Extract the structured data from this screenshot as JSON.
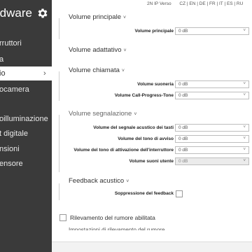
{
  "sidebar": {
    "brand": "rdware",
    "items": [
      {
        "label": "rruttori",
        "active": false
      },
      {
        "label": "a",
        "active": false
      },
      {
        "label": "io",
        "active": true
      },
      {
        "label": "ocamera",
        "active": false
      },
      {
        "label": "oilluminazione",
        "active": false
      },
      {
        "label": "t digitale",
        "active": false
      },
      {
        "label": "nsioni",
        "active": false
      },
      {
        "label": "ensore",
        "active": false
      }
    ]
  },
  "topbar": {
    "version": "2N IP Verso",
    "languages": "CZ | EN | DE | FR | IT | ES | RU"
  },
  "sections": {
    "principale": {
      "title": "Volume principale",
      "rows": [
        {
          "label": "Volume principale",
          "value": "0 dB"
        }
      ]
    },
    "adattativo": {
      "title": "Volume adattativo"
    },
    "chiamata": {
      "title": "Volume chiamata",
      "rows": [
        {
          "label": "Volume suoneria",
          "value": "0 dB"
        },
        {
          "label": "Volume Call-Progress-Tone",
          "value": "0 dB"
        }
      ]
    },
    "segnalazione": {
      "title": "Volume segnalazione",
      "rows": [
        {
          "label": "Volume del segnale acustico dei tasti",
          "value": "0 dB"
        },
        {
          "label": "Volume del tono di avviso",
          "value": "0 dB"
        },
        {
          "label": "Volume del tono di attivazione dell'interruttore",
          "value": "0 dB"
        },
        {
          "label": "Volume suoni utente",
          "value": "0 dB"
        }
      ]
    },
    "feedback": {
      "title": "Feedback acustico",
      "checkbox_label": "Soppressione del feedback",
      "checked": false
    },
    "rumore": {
      "checkbox_label": "Rilevamento del rumore abilitata",
      "checked": false
    },
    "cutoff_text": "Impostazioni di rilevamento del rumore"
  },
  "icons": {
    "gear": "gear-icon",
    "chevron": "chevron-right-icon",
    "caret": "chevron-down-icon"
  },
  "colors": {
    "sidebar_bg": "#3a3a3a",
    "active_item_bg": "#ffffff"
  }
}
